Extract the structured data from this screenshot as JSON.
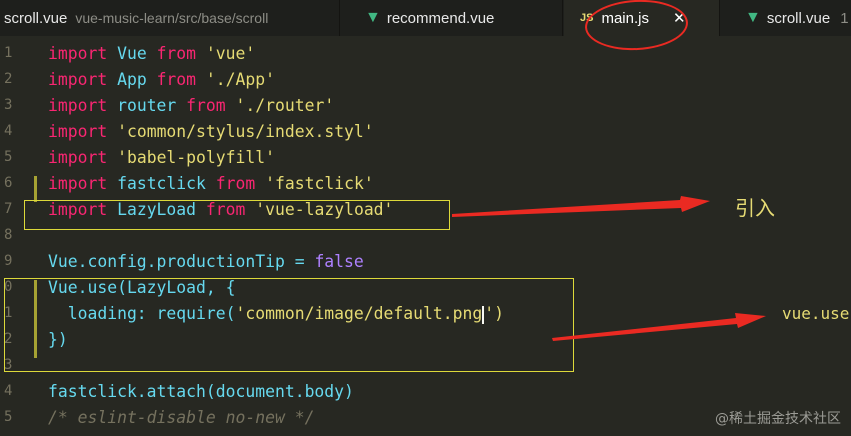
{
  "tabs": [
    {
      "name": "scroll.vue",
      "path": "vue-music-learn/src/base/scroll",
      "icon": "vue-icon",
      "active": false
    },
    {
      "name": "recommend.vue",
      "icon": "vue-icon",
      "active": false
    },
    {
      "name": "main.js",
      "icon": "js-icon",
      "badge": "JS",
      "active": true,
      "close": "✕"
    },
    {
      "name": "scroll.vue",
      "icon": "vue-icon",
      "active": false,
      "suffix": "1"
    }
  ],
  "editor": {
    "line_numbers": [
      "1",
      "2",
      "3",
      "4",
      "5",
      "6",
      "7",
      "8",
      "9",
      "0",
      "1",
      "2",
      "3",
      "4",
      "5"
    ],
    "lines": [
      [
        {
          "t": "import",
          "c": "kw"
        },
        {
          "t": " Vue ",
          "c": "id"
        },
        {
          "t": "from",
          "c": "kw"
        },
        {
          "t": " ",
          "c": "plain"
        },
        {
          "t": "'vue'",
          "c": "str"
        }
      ],
      [
        {
          "t": "import",
          "c": "kw"
        },
        {
          "t": " App ",
          "c": "id"
        },
        {
          "t": "from",
          "c": "kw"
        },
        {
          "t": " ",
          "c": "plain"
        },
        {
          "t": "'./App'",
          "c": "str"
        }
      ],
      [
        {
          "t": "import",
          "c": "kw"
        },
        {
          "t": " router ",
          "c": "id"
        },
        {
          "t": "from",
          "c": "kw"
        },
        {
          "t": " ",
          "c": "plain"
        },
        {
          "t": "'./router'",
          "c": "str"
        }
      ],
      [
        {
          "t": "import",
          "c": "kw"
        },
        {
          "t": " ",
          "c": "plain"
        },
        {
          "t": "'common/stylus/index.styl'",
          "c": "str"
        }
      ],
      [
        {
          "t": "import",
          "c": "kw"
        },
        {
          "t": " ",
          "c": "plain"
        },
        {
          "t": "'babel-polyfill'",
          "c": "str"
        }
      ],
      [
        {
          "t": "import",
          "c": "kw"
        },
        {
          "t": " fastclick ",
          "c": "id"
        },
        {
          "t": "from",
          "c": "kw"
        },
        {
          "t": " ",
          "c": "plain"
        },
        {
          "t": "'fastclick'",
          "c": "str"
        }
      ],
      [
        {
          "t": "import",
          "c": "kw"
        },
        {
          "t": " LazyLoad ",
          "c": "id"
        },
        {
          "t": "from",
          "c": "kw"
        },
        {
          "t": " ",
          "c": "plain"
        },
        {
          "t": "'vue-lazyload'",
          "c": "str"
        }
      ],
      [],
      [
        {
          "t": "Vue.config.productionTip = ",
          "c": "id"
        },
        {
          "t": "false",
          "c": "bool"
        }
      ],
      [
        {
          "t": "Vue.use(LazyLoad, {",
          "c": "id"
        }
      ],
      [
        {
          "t": "  loading: require(",
          "c": "id"
        },
        {
          "t": "'common/image/default.png",
          "c": "str"
        },
        {
          "t": "CARET",
          "c": "caret"
        },
        {
          "t": "')",
          "c": "str"
        }
      ],
      [
        {
          "t": "})",
          "c": "id"
        }
      ],
      [],
      [
        {
          "t": "fastclick.attach(document.body)",
          "c": "id"
        }
      ],
      [
        {
          "t": "/* eslint-disable no-new */",
          "c": "cm"
        }
      ]
    ]
  },
  "annotations": {
    "label_import": "引入",
    "label_use": "vue.use"
  },
  "watermark": "@稀土掘金技术社区",
  "colors": {
    "background": "#272822",
    "keyword": "#f92672",
    "string": "#e6db74",
    "identifier": "#66d9ef",
    "comment": "#75715e",
    "annotation_red": "#ea2a22",
    "highlight_yellow": "#ddd93a"
  }
}
